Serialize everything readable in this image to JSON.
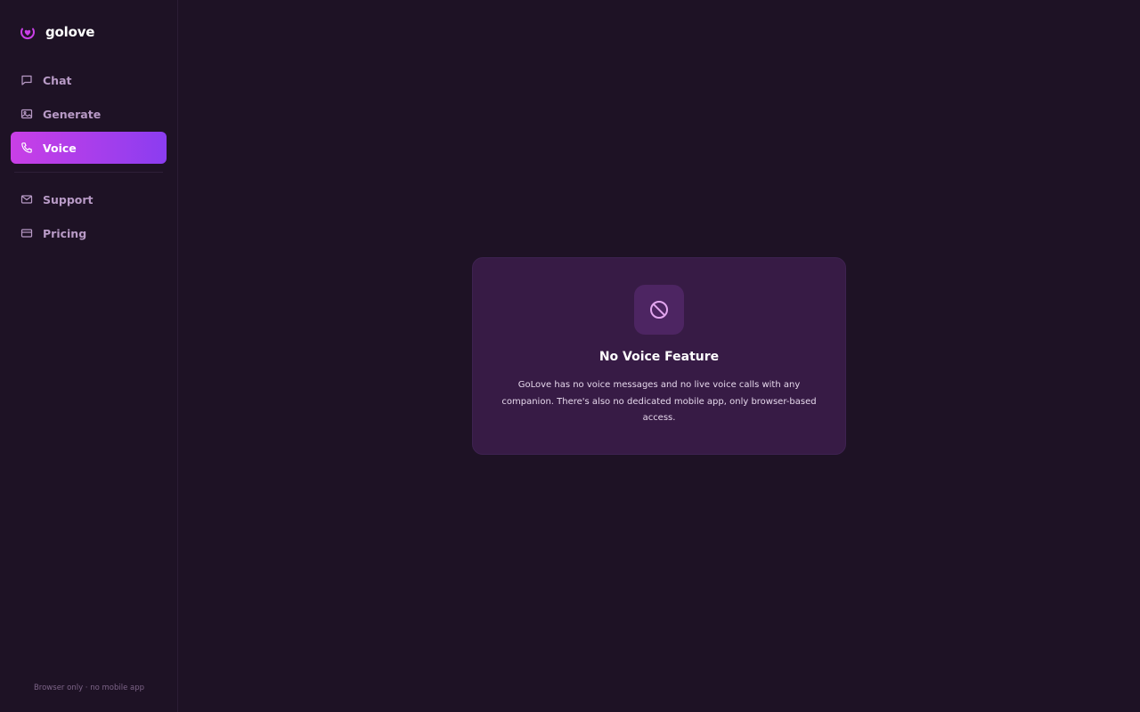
{
  "brand": {
    "name": "golove",
    "icon": "heart-badge-icon",
    "accent": "#c93fe6"
  },
  "sidebar": {
    "primary_items": [
      {
        "label": "Chat",
        "icon": "message-icon",
        "active": false
      },
      {
        "label": "Generate",
        "icon": "image-icon",
        "active": false
      },
      {
        "label": "Voice",
        "icon": "phone-icon",
        "active": true
      }
    ],
    "secondary_items": [
      {
        "label": "Support",
        "icon": "mail-icon",
        "active": false
      },
      {
        "label": "Pricing",
        "icon": "credit-card-icon",
        "active": false
      }
    ],
    "footer_note": "Browser only · no mobile app"
  },
  "main": {
    "card": {
      "icon": "ban-icon",
      "title": "No Voice Feature",
      "body": "GoLove has no voice messages and no live voice calls with any companion. There's also no dedicated mobile app, only browser-based access."
    }
  },
  "colors": {
    "background": "#1e1225",
    "card": "#371b45",
    "active_gradient_start": "#c93fe6",
    "active_gradient_end": "#8b3df0",
    "nav_text": "#b89ac6"
  }
}
